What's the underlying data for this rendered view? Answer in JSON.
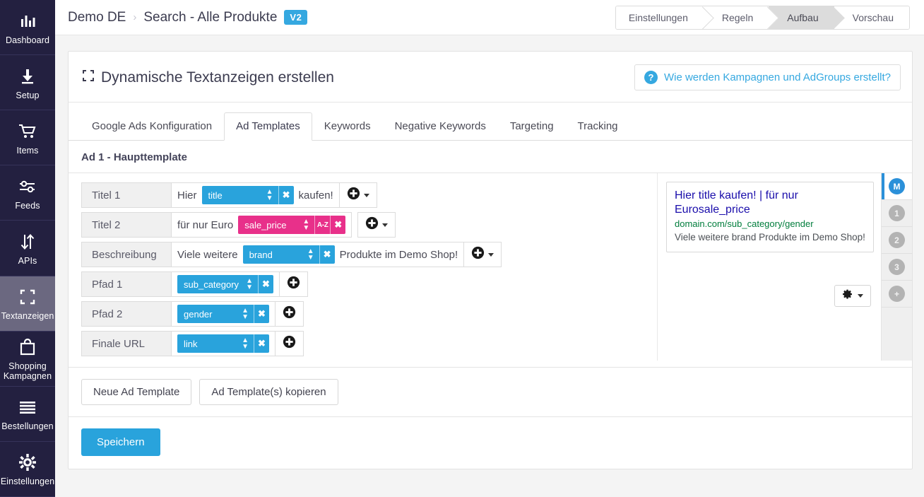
{
  "sidebar": {
    "items": [
      {
        "label": "Dashboard",
        "icon": "bar-chart-icon",
        "active": false
      },
      {
        "label": "Setup",
        "icon": "download-icon",
        "active": false
      },
      {
        "label": "Items",
        "icon": "shopping-cart-icon",
        "active": false
      },
      {
        "label": "Feeds",
        "icon": "sliders-icon",
        "active": false
      },
      {
        "label": "APIs",
        "icon": "arrows-updown-icon",
        "active": false
      },
      {
        "label": "Textanzeigen",
        "icon": "crop-frame-icon",
        "active": true
      },
      {
        "label": "Shopping Kampagnen",
        "icon": "shopping-bag-icon",
        "active": false
      },
      {
        "label": "Bestellungen",
        "icon": "list-lines-icon",
        "active": false
      },
      {
        "label": "Einstellungen",
        "icon": "gear-icon",
        "active": false
      }
    ]
  },
  "topbar": {
    "breadcrumb_root": "Demo DE",
    "breadcrumb_sep": "›",
    "breadcrumb_current": "Search - Alle Produkte",
    "version_badge": "V2",
    "steps": [
      {
        "label": "Einstellungen",
        "current": false
      },
      {
        "label": "Regeln",
        "current": false
      },
      {
        "label": "Aufbau",
        "current": true
      },
      {
        "label": "Vorschau",
        "current": false
      }
    ]
  },
  "card": {
    "title": "Dynamische Textanzeigen erstellen",
    "title_icon": "crop-frame-icon",
    "help_label": "Wie werden Kampagnen und AdGroups erstellt?",
    "help_icon": "question-mark-icon",
    "tabs": [
      {
        "label": "Google Ads Konfiguration",
        "active": false
      },
      {
        "label": "Ad Templates",
        "active": true
      },
      {
        "label": "Keywords",
        "active": false
      },
      {
        "label": "Negative Keywords",
        "active": false
      },
      {
        "label": "Targeting",
        "active": false
      },
      {
        "label": "Tracking",
        "active": false
      }
    ],
    "section_title": "Ad 1 - Haupttemplate"
  },
  "rows": [
    {
      "label": "Titel 1",
      "prefix": "Hier",
      "chip": {
        "value": "title",
        "color": "#29a3dc",
        "has_sort": false,
        "sort_label": "",
        "close": "✖"
      },
      "suffix": "kaufen!",
      "add_icon": "plus-circle-icon",
      "add_has_caret": true,
      "add_attached": true
    },
    {
      "label": "Titel 2",
      "prefix": "für nur Euro",
      "chip": {
        "value": "sale_price",
        "color": "#e8308a",
        "has_sort": true,
        "sort_label": "A-Z",
        "close": "✖"
      },
      "suffix": "",
      "add_icon": "plus-circle-icon",
      "add_has_caret": true,
      "add_attached": false
    },
    {
      "label": "Beschreibung",
      "prefix": "Viele weitere",
      "chip": {
        "value": "brand",
        "color": "#29a3dc",
        "has_sort": false,
        "sort_label": "",
        "close": "✖"
      },
      "suffix": "Produkte im Demo Shop!",
      "add_icon": "plus-circle-icon",
      "add_has_caret": true,
      "add_attached": true
    },
    {
      "label": "Pfad 1",
      "prefix": "",
      "chip": {
        "value": "sub_category",
        "color": "#29a3dc",
        "has_sort": false,
        "sort_label": "",
        "close": "✖"
      },
      "suffix": "",
      "add_icon": "plus-circle-icon",
      "add_has_caret": false,
      "add_attached": true
    },
    {
      "label": "Pfad 2",
      "prefix": "",
      "chip": {
        "value": "gender",
        "color": "#29a3dc",
        "has_sort": false,
        "sort_label": "",
        "close": "✖"
      },
      "suffix": "",
      "add_icon": "plus-circle-icon",
      "add_has_caret": false,
      "add_attached": true
    },
    {
      "label": "Finale URL",
      "prefix": "",
      "chip": {
        "value": "link",
        "color": "#29a3dc",
        "has_sort": false,
        "sort_label": "",
        "close": "✖"
      },
      "suffix": "",
      "add_icon": "plus-circle-icon",
      "add_has_caret": false,
      "add_attached": true
    }
  ],
  "preview": {
    "headline": "Hier title kaufen! | für nur Eurosale_price",
    "url": "domain.com/sub_category/gender",
    "description": "Viele weitere brand Produkte im Demo Shop!",
    "gear_icon": "gear-icon"
  },
  "rail": [
    {
      "label": "M",
      "active": true
    },
    {
      "label": "1",
      "active": false
    },
    {
      "label": "2",
      "active": false
    },
    {
      "label": "3",
      "active": false
    },
    {
      "label": "+",
      "active": false
    }
  ],
  "footer": {
    "new_template": "Neue Ad Template",
    "copy_template": "Ad Template(s) kopieren",
    "save": "Speichern"
  },
  "colors": {
    "accent_blue": "#29a3dc",
    "accent_pink": "#e8308a",
    "sidebar_bg": "#232040",
    "sidebar_active": "#6b6880",
    "preview_link": "#1a0dab",
    "preview_url": "#007d3c"
  }
}
